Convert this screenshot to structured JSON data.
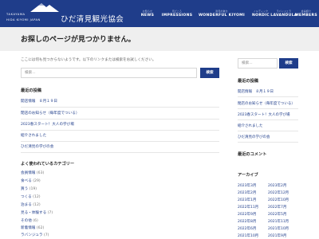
{
  "header": {
    "logo_sub": "TAKAYAMA",
    "logo_en": "HIDA KIYOMI JAPAN",
    "logo_main": "ひだ清見観光協会",
    "nav": [
      {
        "sub": "お知らせ",
        "label": "NEWS"
      },
      {
        "sub": "見どころ",
        "label": "IMPRESSIONS"
      },
      {
        "sub": "清見の魅力",
        "label": "WONDERFUL KIYOMI"
      },
      {
        "sub": "ノルディック",
        "label": "NORDIC"
      },
      {
        "sub": "ラバンジュラ",
        "label": "LAVANDULA"
      },
      {
        "sub": "会員紹介",
        "label": "MEMBERS"
      }
    ]
  },
  "page": {
    "title": "お探しのページが見つかりません。",
    "notice": "ここには何も見つからないようです。以下のリンクまたは検索をお試しください。",
    "search_placeholder": "検索...",
    "search_button": "検索"
  },
  "recent": {
    "heading": "最近の投稿",
    "items": [
      "開店情報　８月１９日",
      "閉店のお知らせ（毎年度でついる）",
      "2023春スタート！大人の学び場",
      "紹介されました",
      "ひだ清見の学びの会"
    ]
  },
  "categories": {
    "heading": "よく使われているカテゴリー",
    "items": [
      {
        "name": "会員情報",
        "count": "(63)"
      },
      {
        "name": "食べる",
        "count": "(29)"
      },
      {
        "name": "買う",
        "count": "(19)"
      },
      {
        "name": "つくる",
        "count": "(12)"
      },
      {
        "name": "泊まる",
        "count": "(12)"
      },
      {
        "name": "見る・体験する",
        "count": "(7)"
      },
      {
        "name": "その他",
        "count": "(6)"
      },
      {
        "name": "新着情報",
        "count": "(62)"
      },
      {
        "name": "ラバンジュラ",
        "count": "(7)"
      }
    ]
  },
  "sidebar": {
    "search_placeholder": "検索...",
    "search_button": "検索",
    "recent_heading": "最近の投稿",
    "recent_items": [
      "開店情報　８月１９日",
      "閉店のお知らせ（毎年度でついる）",
      "2023春スタート！大人の学び場",
      "紹介されました",
      "ひだ清見の学びの会"
    ],
    "comments_heading": "最近のコメント",
    "archive_heading": "アーカイブ",
    "archive_left": [
      "2023年3月",
      "2023年2月",
      "2023年1月",
      "2022年11月",
      "2022年9月",
      "2022年8月",
      "2022年6月",
      "2021年10月"
    ],
    "archive_right": [
      "2023年2月",
      "2022年12月",
      "2022年10月",
      "2022年7月",
      "2022年5月",
      "2021年11月",
      "2021年10月",
      "2021年9月"
    ]
  },
  "colors": {
    "brand": "#1f3d8a"
  }
}
